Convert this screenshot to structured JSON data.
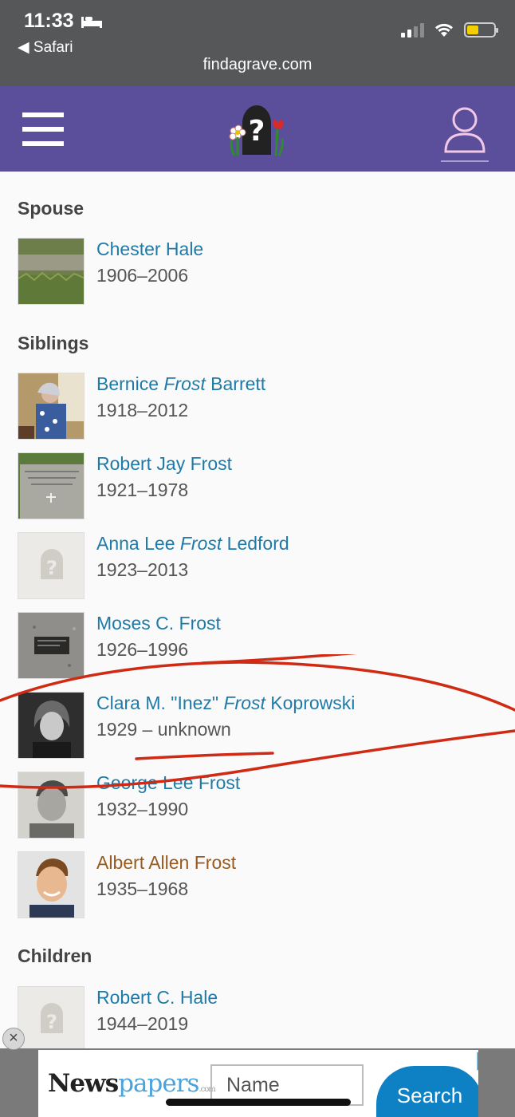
{
  "status_bar": {
    "time": "11:33",
    "back_label": "◀ Safari",
    "url": "findagrave.com",
    "battery_color": "#f2d000"
  },
  "nav": {
    "menu_icon": "hamburger-icon",
    "logo_icon": "findagrave-logo-icon",
    "account_icon": "user-icon",
    "bg_color": "#5b4e9b"
  },
  "sections": {
    "spouse": "Spouse",
    "siblings": "Siblings",
    "children": "Children"
  },
  "spouse": [
    {
      "first": "Chester Hale",
      "maiden": "",
      "last": "",
      "dates": "1906–2006"
    }
  ],
  "siblings": [
    {
      "first": "Bernice",
      "maiden": "Frost",
      "last": "Barrett",
      "dates": "1918–2012"
    },
    {
      "first": "Robert Jay Frost",
      "maiden": "",
      "last": "",
      "dates": "1921–1978"
    },
    {
      "first": "Anna Lee",
      "maiden": "Frost",
      "last": "Ledford",
      "dates": "1923–2013"
    },
    {
      "first": "Moses C. Frost",
      "maiden": "",
      "last": "",
      "dates": "1926–1996"
    },
    {
      "first": "Clara M. \"Inez\"",
      "maiden": "Frost",
      "last": "Koprowski",
      "dates": "1929 – unknown"
    },
    {
      "first": "George Lee Frost",
      "maiden": "",
      "last": "",
      "dates": "1932–1990"
    },
    {
      "first": "Albert Allen Frost",
      "maiden": "",
      "last": "",
      "dates": "1935–1968"
    }
  ],
  "children": [
    {
      "first": "Robert C. Hale",
      "maiden": "",
      "last": "",
      "dates": "1944–2019"
    }
  ],
  "ad": {
    "brand_news": "News",
    "brand_papers": "papers",
    "brand_com": ".com",
    "input_placeholder": "Name",
    "search_label": "Search",
    "close_label": "×"
  }
}
